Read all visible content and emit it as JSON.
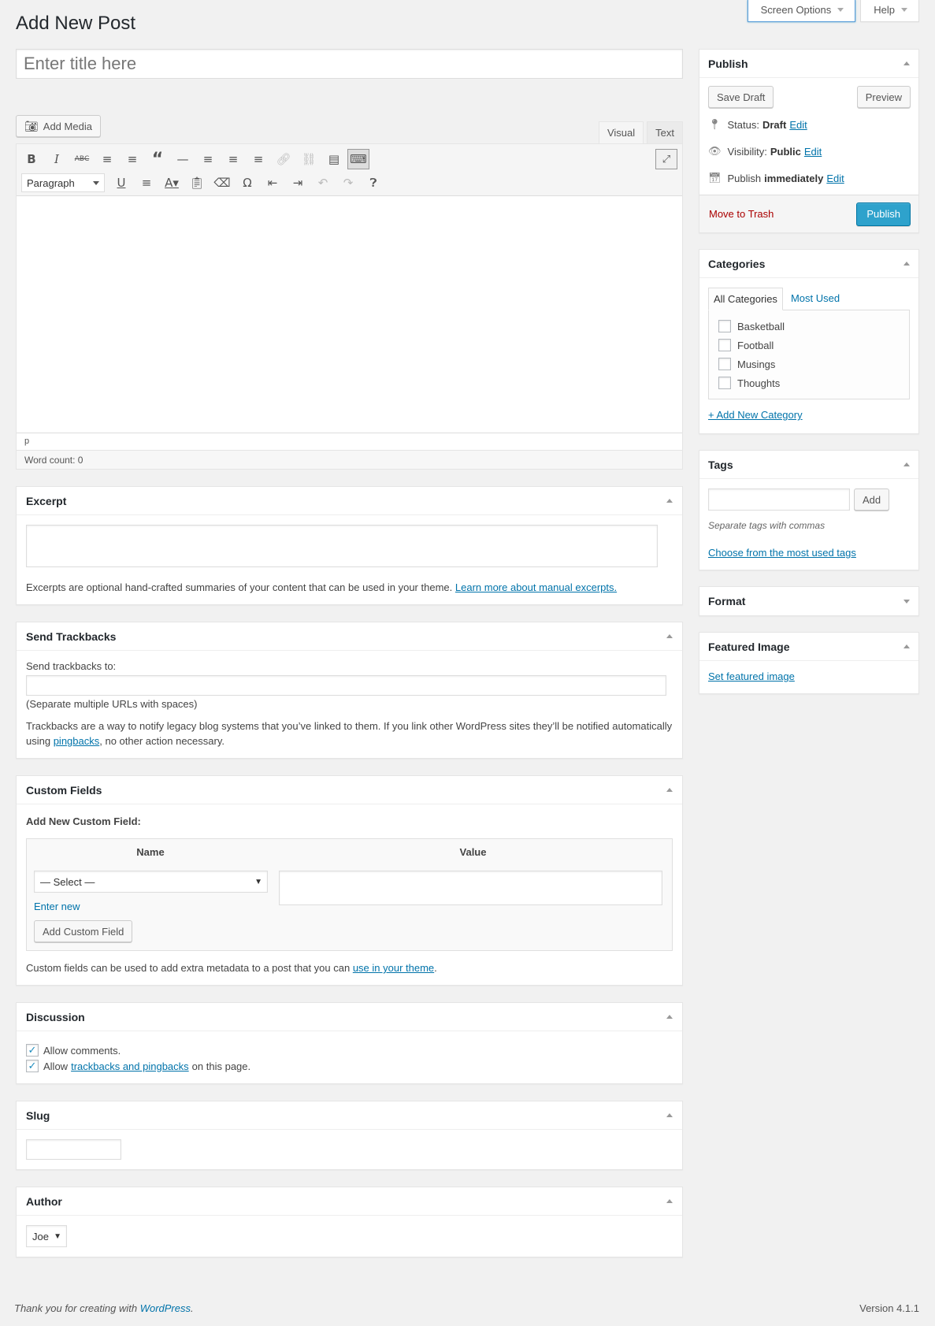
{
  "screen_meta": {
    "screen_options": "Screen Options",
    "help": "Help"
  },
  "page_title": "Add New Post",
  "title_placeholder": "Enter title here",
  "editor": {
    "add_media": "Add Media",
    "tabs": [
      "Visual",
      "Text"
    ],
    "active_tab": "Visual",
    "format_select": "Paragraph",
    "path": "p",
    "word_count": "Word count: 0"
  },
  "excerpt": {
    "title": "Excerpt",
    "help_text": "Excerpts are optional hand-crafted summaries of your content that can be used in your theme.",
    "help_link": "Learn more about manual excerpts."
  },
  "trackbacks": {
    "title": "Send Trackbacks",
    "label": "Send trackbacks to:",
    "hint": "(Separate multiple URLs with spaces)",
    "desc_1": "Trackbacks are a way to notify legacy blog systems that you’ve linked to them. If you link other WordPress sites they’ll be notified automatically using",
    "desc_link": "pingbacks",
    "desc_2": ", no other action necessary."
  },
  "custom_fields": {
    "title": "Custom Fields",
    "subtitle": "Add New Custom Field:",
    "col_name": "Name",
    "col_value": "Value",
    "select_value": "— Select —",
    "enter_new": "Enter new",
    "add_button": "Add Custom Field",
    "help_text": "Custom fields can be used to add extra metadata to a post that you can",
    "help_link": "use in your theme",
    "help_end": "."
  },
  "discussion": {
    "title": "Discussion",
    "allow_comments": "Allow comments.",
    "allow_tp_prefix": "Allow",
    "allow_tp_link": "trackbacks and pingbacks",
    "allow_tp_suffix": "on this page."
  },
  "slug": {
    "title": "Slug"
  },
  "author": {
    "title": "Author",
    "value": "Joe"
  },
  "publish": {
    "title": "Publish",
    "save_draft": "Save Draft",
    "preview": "Preview",
    "status_label": "Status:",
    "status_value": "Draft",
    "visibility_label": "Visibility:",
    "visibility_value": "Public",
    "publish_label": "Publish",
    "publish_value": "immediately",
    "edit": "Edit",
    "trash": "Move to Trash",
    "publish_button": "Publish"
  },
  "categories": {
    "title": "Categories",
    "tab_all": "All Categories",
    "tab_most": "Most Used",
    "items": [
      "Basketball",
      "Football",
      "Musings",
      "Thoughts"
    ],
    "add_new": "+ Add New Category"
  },
  "tags": {
    "title": "Tags",
    "add_button": "Add",
    "hint": "Separate tags with commas",
    "choose": "Choose from the most used tags"
  },
  "format": {
    "title": "Format"
  },
  "featured_image": {
    "title": "Featured Image",
    "link": "Set featured image"
  },
  "footer": {
    "thanks": "Thank you for creating with",
    "wordpress": "WordPress",
    "period": ".",
    "version": "Version 4.1.1"
  },
  "colors": {
    "link": "#0073aa",
    "primary": "#2ea2cc",
    "danger": "#a00"
  }
}
